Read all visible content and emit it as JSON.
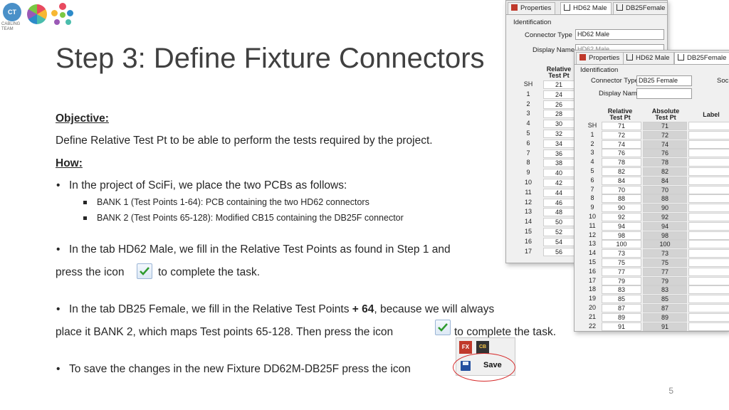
{
  "logo": {
    "ct": "CT",
    "line1": "CABLING",
    "line2": "TEAM"
  },
  "title": "Step 3: Define Fixture Connectors",
  "objective_heading": "Objective:",
  "objective_text": "Define Relative Test Pt to be able to perform the tests required by the project.",
  "how_heading": "How:",
  "bullet1": "In the project of SciFi, we place the two PCBs as follows:",
  "sub1": "BANK 1 (Test Points 1-64): PCB containing the two HD62 connectors",
  "sub2": "BANK 2 (Test Points 65-128): Modified CB15 containing the DB25F connector",
  "bullet2_line1": "In the tab HD62 Male, we fill in the Relative Test Points as found in Step 1 and",
  "bullet2_line2a": "press the icon",
  "bullet2_line2b": "to complete the task.",
  "bullet3_line1a": "In the tab DB25 Female, we fill in the Relative Test Points ",
  "bullet3_bold": "+ 64",
  "bullet3_line1b": ", because we will always",
  "bullet3_line2a": "place it BANK 2, which maps Test points 65-128. Then press the icon",
  "bullet3_line2b": "to complete the task.",
  "bullet4": "To save the changes in the new Fixture DD62M-DB25F press the icon",
  "page_number": "5",
  "win_hd62": {
    "tabs": [
      "Properties",
      "HD62 Male",
      "DB25Female"
    ],
    "identification": "Identification",
    "connector_type_label": "Connector Type",
    "connector_type_value": "HD62 Male",
    "display_name_label": "Display Name",
    "display_name_value": "HD62 Male",
    "col_header": "Relative\nTest Pt",
    "rows": [
      {
        "n": "SH",
        "v": "21"
      },
      {
        "n": "1",
        "v": "24"
      },
      {
        "n": "2",
        "v": "26"
      },
      {
        "n": "3",
        "v": "28"
      },
      {
        "n": "4",
        "v": "30"
      },
      {
        "n": "5",
        "v": "32"
      },
      {
        "n": "6",
        "v": "34"
      },
      {
        "n": "7",
        "v": "36"
      },
      {
        "n": "8",
        "v": "38"
      },
      {
        "n": "9",
        "v": "40"
      },
      {
        "n": "10",
        "v": "42"
      },
      {
        "n": "11",
        "v": "44"
      },
      {
        "n": "12",
        "v": "46"
      },
      {
        "n": "13",
        "v": "48"
      },
      {
        "n": "14",
        "v": "50"
      },
      {
        "n": "15",
        "v": "52"
      },
      {
        "n": "16",
        "v": "54"
      },
      {
        "n": "17",
        "v": "56"
      }
    ]
  },
  "win_db25": {
    "tabs": [
      "Properties",
      "HD62 Male",
      "DB25Female"
    ],
    "identification": "Identification",
    "connector_type_label": "Connector Type",
    "connector_type_value": "DB25 Female",
    "display_name_label": "Display Name",
    "display_name_value": "",
    "right_label": "Soc",
    "col_relative": "Relative\nTest Pt",
    "col_absolute": "Absolute\nTest Pt",
    "col_label": "Label",
    "rows": [
      {
        "n": "SH",
        "r": "71",
        "a": "71"
      },
      {
        "n": "1",
        "r": "72",
        "a": "72"
      },
      {
        "n": "2",
        "r": "74",
        "a": "74"
      },
      {
        "n": "3",
        "r": "76",
        "a": "76"
      },
      {
        "n": "4",
        "r": "78",
        "a": "78"
      },
      {
        "n": "5",
        "r": "82",
        "a": "82"
      },
      {
        "n": "6",
        "r": "84",
        "a": "84"
      },
      {
        "n": "7",
        "r": "70",
        "a": "70"
      },
      {
        "n": "8",
        "r": "88",
        "a": "88"
      },
      {
        "n": "9",
        "r": "90",
        "a": "90"
      },
      {
        "n": "10",
        "r": "92",
        "a": "92"
      },
      {
        "n": "11",
        "r": "94",
        "a": "94"
      },
      {
        "n": "12",
        "r": "98",
        "a": "98"
      },
      {
        "n": "13",
        "r": "100",
        "a": "100"
      },
      {
        "n": "14",
        "r": "73",
        "a": "73"
      },
      {
        "n": "15",
        "r": "75",
        "a": "75"
      },
      {
        "n": "16",
        "r": "77",
        "a": "77"
      },
      {
        "n": "17",
        "r": "79",
        "a": "79"
      },
      {
        "n": "18",
        "r": "83",
        "a": "83"
      },
      {
        "n": "19",
        "r": "85",
        "a": "85"
      },
      {
        "n": "20",
        "r": "87",
        "a": "87"
      },
      {
        "n": "21",
        "r": "89",
        "a": "89"
      },
      {
        "n": "22",
        "r": "91",
        "a": "91"
      }
    ]
  },
  "toolbar": {
    "save_label": "Save"
  },
  "colors": {
    "accent_red": "#d62a2a",
    "check_green": "#2e9b2e",
    "title_gray": "#404040"
  }
}
